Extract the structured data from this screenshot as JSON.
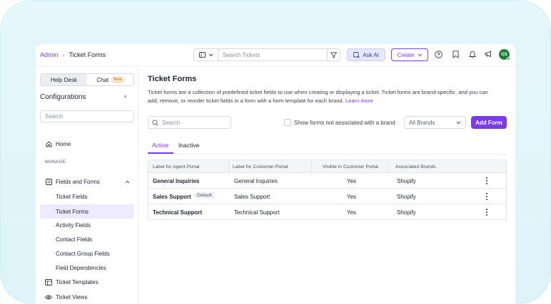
{
  "header": {
    "breadcrumb_root": "Admin",
    "breadcrumb_sep": "›",
    "breadcrumb_current": "Ticket Forms",
    "search_placeholder": "Search Tickets",
    "ask_ai_label": "Ask AI",
    "create_label": "Create",
    "avatar_initials": "GS"
  },
  "sidebar": {
    "toggle": {
      "helpdesk": "Help Desk",
      "chat": "Chat",
      "chat_badge": "Beta"
    },
    "title": "Configurations",
    "collapse_glyph": "‹",
    "search_placeholder": "Search",
    "home_label": "Home",
    "section_manage": "MANAGE",
    "fields_and_forms_label": "Fields and Forms",
    "sub_items": [
      {
        "label": "Ticket Fields"
      },
      {
        "label": "Ticket Forms"
      },
      {
        "label": "Activity Fields"
      },
      {
        "label": "Contact Fields"
      },
      {
        "label": "Contact Group Fields"
      },
      {
        "label": "Field Dependencies"
      }
    ],
    "ticket_templates_label": "Ticket Templates",
    "ticket_views_label": "Ticket Views"
  },
  "main": {
    "title": "Ticket Forms",
    "description": "Ticket forms are a collection of predefined ticket fields to use when creating or displaying a ticket. Ticket forms are brand-specific, and you can add, remove, or reorder ticket fields in a form with a form template for each brand.",
    "learn_more": "Learn more",
    "search_placeholder": "Search",
    "checkbox_label": "Show forms not associated with a brand",
    "brand_select_value": "All Brands",
    "add_form_label": "Add Form",
    "tabs": {
      "active": "Active",
      "inactive": "Inactive"
    },
    "table": {
      "headers": {
        "agent": "Label for Agent Portal",
        "customer": "Label for Customer Portal",
        "visible": "Visible in Customer Portal",
        "brands": "Associated Brands"
      },
      "rows": [
        {
          "agent": "General Inquiries",
          "badge": "",
          "customer": "General Inquiries",
          "visible": "Yes",
          "brands": "Shopify"
        },
        {
          "agent": "Sales Support",
          "badge": "Default",
          "customer": "Sales Support",
          "visible": "Yes",
          "brands": "Shopify"
        },
        {
          "agent": "Technical Support",
          "badge": "",
          "customer": "Technical Support",
          "visible": "Yes",
          "brands": "Shopify"
        }
      ]
    }
  },
  "colors": {
    "accent": "#7c3aed",
    "avatar": "#1e7d32",
    "frame": "#e6f7fb"
  }
}
